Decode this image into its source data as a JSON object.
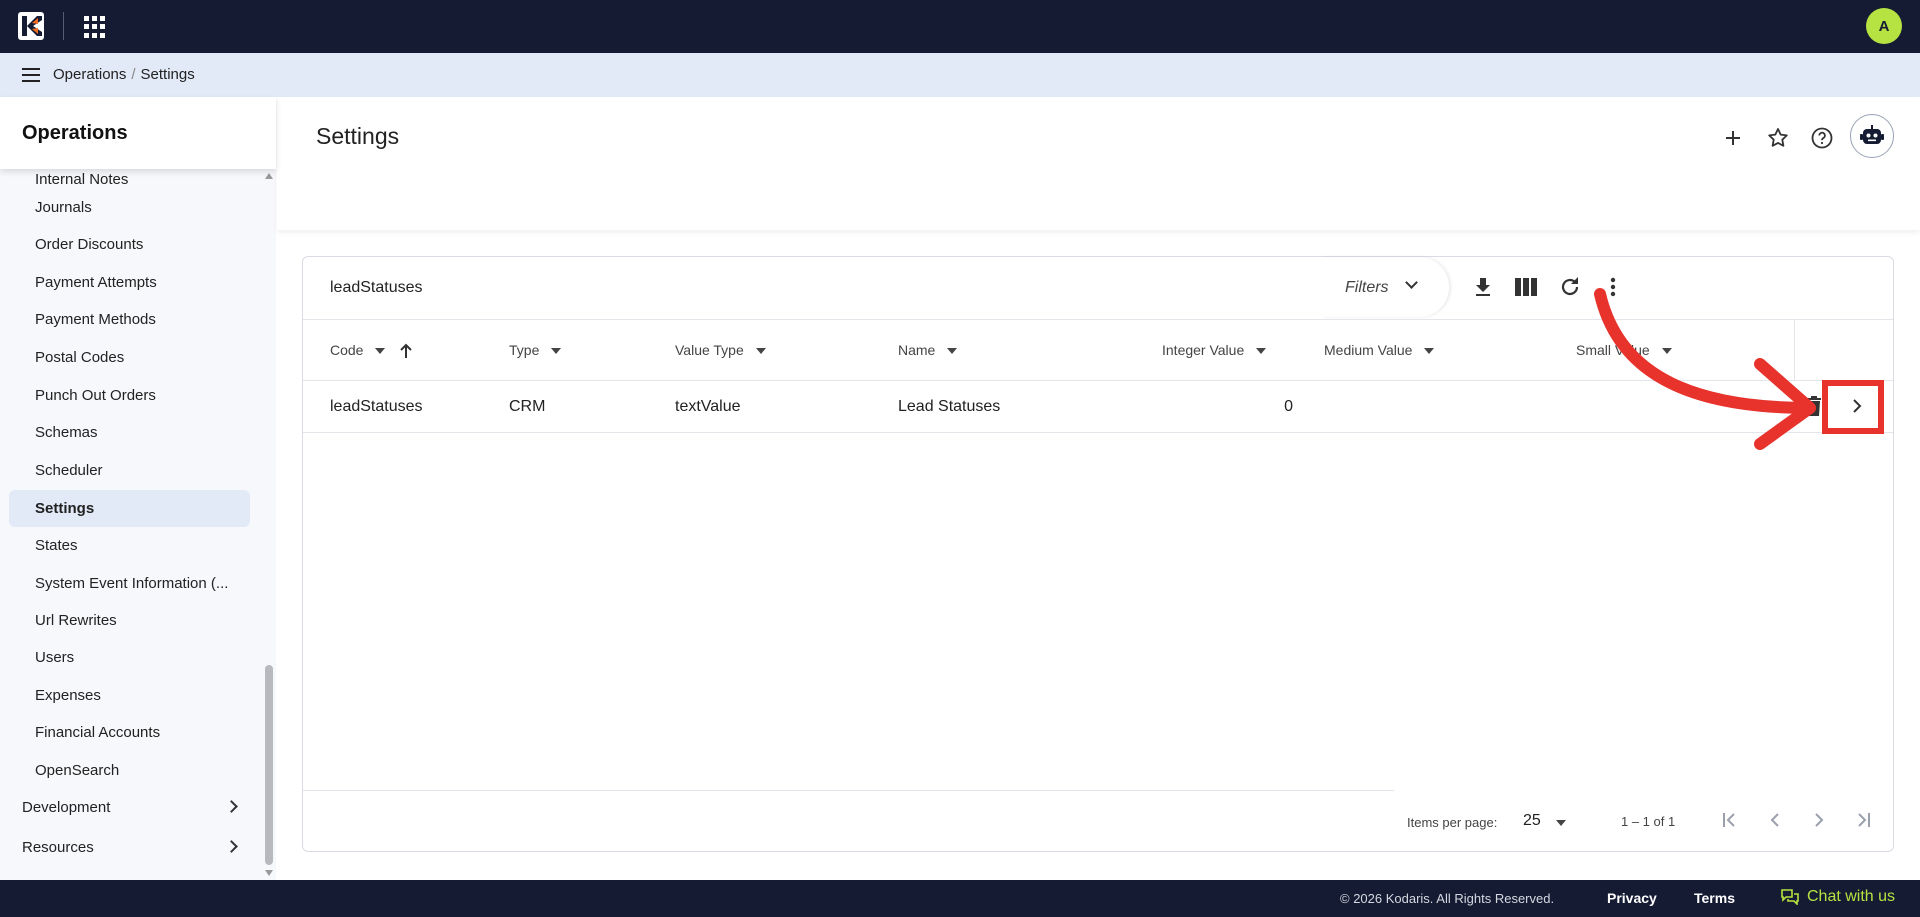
{
  "topbar": {
    "avatar_initial": "A"
  },
  "breadcrumb": {
    "parent": "Operations",
    "separator": "/",
    "current": "Settings"
  },
  "sidebar": {
    "title": "Operations",
    "items": [
      {
        "label": "Internal Notes"
      },
      {
        "label": "Journals"
      },
      {
        "label": "Order Discounts"
      },
      {
        "label": "Payment Attempts"
      },
      {
        "label": "Payment Methods"
      },
      {
        "label": "Postal Codes"
      },
      {
        "label": "Punch Out Orders"
      },
      {
        "label": "Schemas"
      },
      {
        "label": "Scheduler"
      },
      {
        "label": "Settings"
      },
      {
        "label": "States"
      },
      {
        "label": "System Event Information (..."
      },
      {
        "label": "Url Rewrites"
      },
      {
        "label": "Users"
      },
      {
        "label": "Expenses"
      },
      {
        "label": "Financial Accounts"
      },
      {
        "label": "OpenSearch"
      }
    ],
    "active_item": "Settings",
    "groups": [
      {
        "label": "Development"
      },
      {
        "label": "Resources"
      }
    ]
  },
  "page": {
    "title": "Settings"
  },
  "grid": {
    "title": "leadStatuses",
    "filters_label": "Filters",
    "columns": [
      {
        "label": "Code"
      },
      {
        "label": "Type"
      },
      {
        "label": "Value Type"
      },
      {
        "label": "Name"
      },
      {
        "label": "Integer Value"
      },
      {
        "label": "Medium Value"
      },
      {
        "label": "Small Value"
      }
    ],
    "rows": [
      {
        "code": "leadStatuses",
        "type": "CRM",
        "value_type": "textValue",
        "name": "Lead Statuses",
        "integer_value": "0",
        "medium_value": "",
        "small_value": ""
      }
    ],
    "pagination": {
      "items_per_page_label": "Items per page:",
      "items_per_page": "25",
      "range": "1 – 1 of 1"
    }
  },
  "footer": {
    "copyright": "© 2026 Kodaris. All Rights Reserved.",
    "privacy": "Privacy",
    "terms": "Terms",
    "chat": "Chat with us"
  },
  "colors": {
    "topbar_bg": "#141b33",
    "breadcrumb_bg": "#e2e9f7",
    "accent": "#b6e342",
    "annotation": "#e8322c",
    "logo_orange": "#f26b21"
  },
  "icons": [
    "kodaris-logo",
    "apps-grid-icon",
    "menu-icon",
    "plus-icon",
    "star-icon",
    "help-icon",
    "robot-icon",
    "download-icon",
    "columns-icon",
    "refresh-icon",
    "more-vert-icon",
    "sort-up-arrow-icon",
    "trash-icon",
    "chevron-right-icon",
    "first-page-icon",
    "prev-page-icon",
    "next-page-icon",
    "last-page-icon",
    "chat-icon"
  ]
}
